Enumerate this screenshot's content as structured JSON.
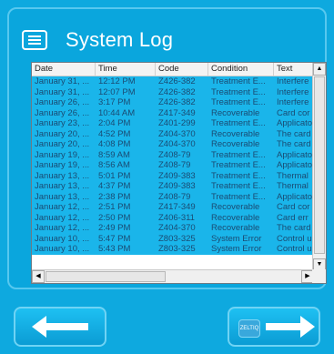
{
  "app": {
    "title": "System Log"
  },
  "table": {
    "columns": [
      "Date",
      "Time",
      "Code",
      "Condition",
      "Text"
    ],
    "rows": [
      [
        "January 31, ...",
        "12:12 PM",
        "Z426-382",
        "Treatment E...",
        "Interfere"
      ],
      [
        "January 31, ...",
        "12:07 PM",
        "Z426-382",
        "Treatment E...",
        "Interfere"
      ],
      [
        "January 26, ...",
        "3:17 PM",
        "Z426-382",
        "Treatment E...",
        "Interfere"
      ],
      [
        "January 26, ...",
        "10:44 AM",
        "Z417-349",
        "Recoverable",
        "Card cor"
      ],
      [
        "January 23, ...",
        "2:04 PM",
        "Z401-299",
        "Treatment E...",
        "Applicato"
      ],
      [
        "January 20, ...",
        "4:52 PM",
        "Z404-370",
        "Recoverable",
        "The card"
      ],
      [
        "January 20, ...",
        "4:08 PM",
        "Z404-370",
        "Recoverable",
        "The card"
      ],
      [
        "January 19, ...",
        "8:59 AM",
        "Z408-79",
        "Treatment E...",
        "Applicato"
      ],
      [
        "January 19, ...",
        "8:56 AM",
        "Z408-79",
        "Treatment E...",
        "Applicato"
      ],
      [
        "January 13, ...",
        "5:01 PM",
        "Z409-383",
        "Treatment E...",
        "Thermal"
      ],
      [
        "January 13, ...",
        "4:37 PM",
        "Z409-383",
        "Treatment E...",
        "Thermal"
      ],
      [
        "January 13, ...",
        "2:38 PM",
        "Z408-79",
        "Treatment E...",
        "Applicato"
      ],
      [
        "January 12, ...",
        "2:51 PM",
        "Z417-349",
        "Recoverable",
        "Card cor"
      ],
      [
        "January 12, ...",
        "2:50 PM",
        "Z406-311",
        "Recoverable",
        "Card err"
      ],
      [
        "January 12, ...",
        "2:49 PM",
        "Z404-370",
        "Recoverable",
        "The card"
      ],
      [
        "January 10, ...",
        "5:47 PM",
        "Z803-325",
        "System Error",
        "Control u"
      ],
      [
        "January 10, ...",
        "5:43 PM",
        "Z803-325",
        "System Error",
        "Control u"
      ]
    ]
  },
  "scroll": {
    "up_glyph": "▲",
    "down_glyph": "▼",
    "left_glyph": "◀",
    "right_glyph": "▶"
  },
  "nav": {
    "back_icon": "arrow-left",
    "next_icon": "arrow-right",
    "brand_label": "ZELTIQ"
  },
  "colors": {
    "background": "#0ea9df",
    "row_highlight": "#1ab5ea",
    "text": "#1a4b73"
  }
}
